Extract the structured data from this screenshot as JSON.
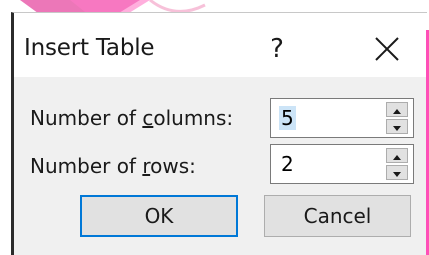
{
  "dialog": {
    "title": "Insert Table",
    "help_label": "?",
    "columns": {
      "label_before": "Number of ",
      "label_access": "c",
      "label_after": "olumns:",
      "value": "5"
    },
    "rows": {
      "label_before": "Number of ",
      "label_access": "r",
      "label_after": "ows:",
      "value": "2"
    },
    "ok_label": "OK",
    "cancel_label": "Cancel"
  },
  "colors": {
    "default_button_border": "#0078d7",
    "selection": "#cce4f7",
    "watermark": "#f3a6c9"
  }
}
